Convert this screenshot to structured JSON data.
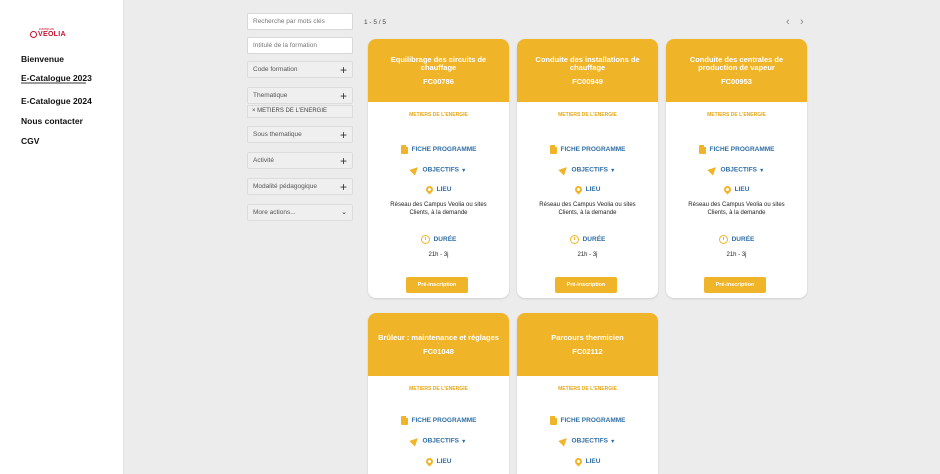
{
  "logo": {
    "small_text": "campus",
    "brand_text": "VEOLIA"
  },
  "sidebar": {
    "items": [
      {
        "label": "Bienvenue"
      },
      {
        "label": "E-Catalogue 2023"
      },
      {
        "label": "E-Catalogue 2024"
      },
      {
        "label": "Nous contacter"
      },
      {
        "label": "CGV"
      }
    ]
  },
  "filters": {
    "keywords_placeholder": "Recherche par mots clés",
    "title_placeholder": "Intitulé de la formation",
    "code_label": "Code formation",
    "thematique_label": "Thematique",
    "thematique_chip": "× METIERS DE L'ENERGIE",
    "sous_thematique_label": "Sous thematique",
    "activite_label": "Activité",
    "modalite_label": "Modalité pédagogique",
    "more_label": "More actions...",
    "plus_glyph": "+",
    "chevron_glyph": "⌄"
  },
  "results": {
    "count": "1 - 5 / 5",
    "prev_glyph": "‹",
    "next_glyph": "›"
  },
  "labels": {
    "fiche": "FICHE PROGRAMME",
    "objectifs": "OBJECTIFS",
    "caret": "▼",
    "lieu": "LIEU",
    "duree": "DURÉE",
    "cta": "Pré-inscription",
    "dash": "-"
  },
  "cards": [
    {
      "title": "Equilibrage des circuits de chauffage",
      "code": "FC00786",
      "category": "METIERS DE L'ENERGIE",
      "lieu": "Réseau des Campus Veolia ou sites Clients, à la demande",
      "duree": "21h - 3j"
    },
    {
      "title": "Conduite des installations de chauffage",
      "code": "FC00949",
      "category": "METIERS DE L'ENERGIE",
      "lieu": "Réseau des Campus Veolia ou sites Clients, à la demande",
      "duree": "21h - 3j"
    },
    {
      "title": "Conduite des centrales de production de vapeur",
      "code": "FC00953",
      "category": "METIERS DE L'ENERGIE",
      "lieu": "Réseau des Campus Veolia ou sites Clients, à la demande",
      "duree": "21h - 3j"
    },
    {
      "title": "Brûleur : maintenance et réglages",
      "code": "FC01048",
      "category": "METIERS DE L'ENERGIE"
    },
    {
      "title": "Parcours thermicien",
      "code": "FC02112",
      "category": "METIERS DE L'ENERGIE"
    }
  ],
  "colors": {
    "accent": "#f0b428",
    "link": "#2f6ea5",
    "brand": "#c8102e"
  }
}
